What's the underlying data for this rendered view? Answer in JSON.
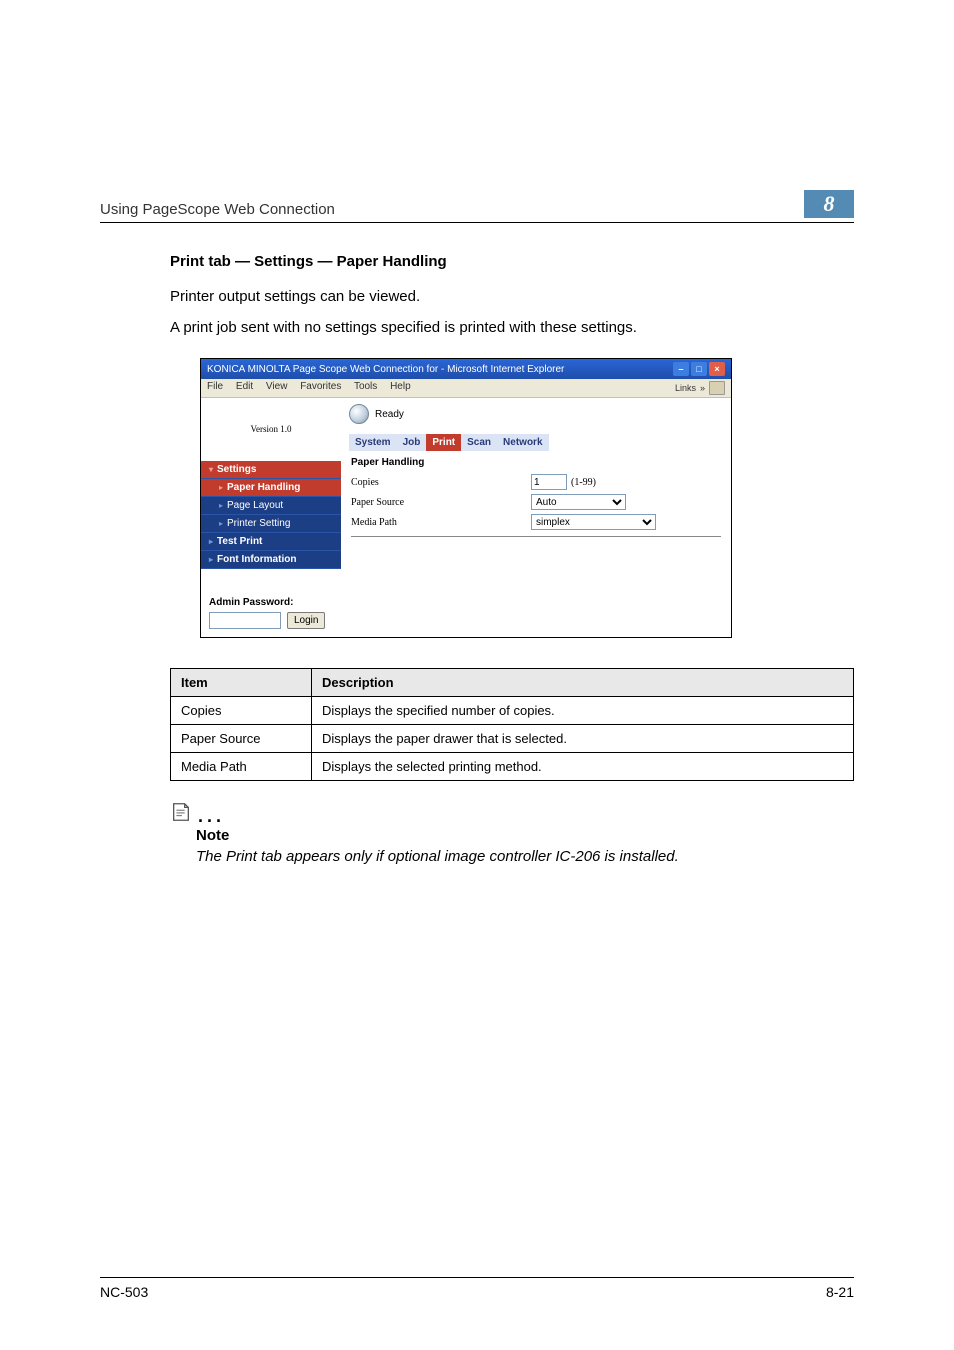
{
  "header": {
    "running_head": "Using PageScope Web Connection",
    "chapter_number": "8"
  },
  "section": {
    "title": "Print tab — Settings — Paper Handling",
    "p1": "Printer output settings can be viewed.",
    "p2": "A print job sent with no settings specified is printed with these settings."
  },
  "screenshot": {
    "window_title": "KONICA MINOLTA Page Scope Web Connection for       - Microsoft Internet Explorer",
    "menubar": {
      "file": "File",
      "edit": "Edit",
      "view": "View",
      "favorites": "Favorites",
      "tools": "Tools",
      "help": "Help",
      "links": "Links",
      "links_chev": "»"
    },
    "version": "Version 1.0",
    "nav": {
      "settings": "Settings",
      "paper_handling": "Paper Handling",
      "page_layout": "Page Layout",
      "printer_setting": "Printer Setting",
      "test_print": "Test Print",
      "font_information": "Font Information"
    },
    "admin": {
      "label": "Admin Password:",
      "login": "Login"
    },
    "status": "Ready",
    "tabs": {
      "system": "System",
      "job": "Job",
      "print": "Print",
      "scan": "Scan",
      "network": "Network"
    },
    "panel": {
      "title": "Paper Handling",
      "copies_label": "Copies",
      "copies_value": "1",
      "copies_hint": "(1-99)",
      "paper_source_label": "Paper Source",
      "paper_source_value": "Auto",
      "media_path_label": "Media Path",
      "media_path_value": "simplex"
    }
  },
  "table": {
    "h1": "Item",
    "h2": "Description",
    "rows": [
      {
        "item": "Copies",
        "desc": "Displays the specified number of copies."
      },
      {
        "item": "Paper Source",
        "desc": "Displays the paper drawer that is selected."
      },
      {
        "item": "Media Path",
        "desc": "Displays the selected printing method."
      }
    ]
  },
  "note": {
    "dots": "...",
    "label": "Note",
    "text": "The Print tab appears only if optional image controller IC-206 is installed."
  },
  "footer": {
    "left": "NC-503",
    "right": "8-21"
  }
}
